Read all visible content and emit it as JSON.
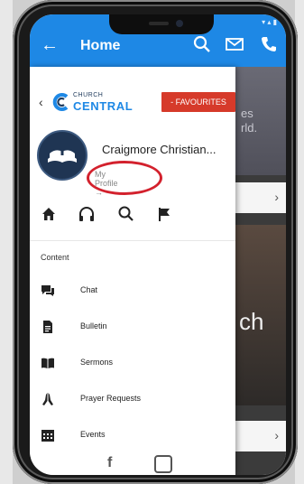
{
  "app_bar": {
    "title": "Home",
    "bg_color": "#1e88e5",
    "icons": [
      "back-arrow-icon",
      "search-icon",
      "mail-icon",
      "phone-icon"
    ]
  },
  "drawer": {
    "brand": {
      "small_text": "CHURCH",
      "big_text": "CENTRAL"
    },
    "favourites_button": "- FAVOURITES",
    "favourites_color": "#d63a2a",
    "profile": {
      "church_name": "Craigmore Christian...",
      "profile_link": "My Profile →"
    },
    "shortcuts": [
      "home-icon",
      "headphones-icon",
      "search-icon",
      "flag-icon"
    ],
    "section_label": "Content",
    "menu_items": [
      {
        "label": "Chat",
        "icon": "chat-icon"
      },
      {
        "label": "Bulletin",
        "icon": "document-icon"
      },
      {
        "label": "Sermons",
        "icon": "book-icon"
      },
      {
        "label": "Prayer Requests",
        "icon": "praying-hands-icon"
      },
      {
        "label": "Events",
        "icon": "calendar-icon"
      }
    ],
    "social": [
      "facebook-icon",
      "instagram-icon"
    ]
  },
  "behind_content": {
    "hero_text": "es\nrld.",
    "big_text": "ch"
  },
  "annotation_color": "#d3212d"
}
